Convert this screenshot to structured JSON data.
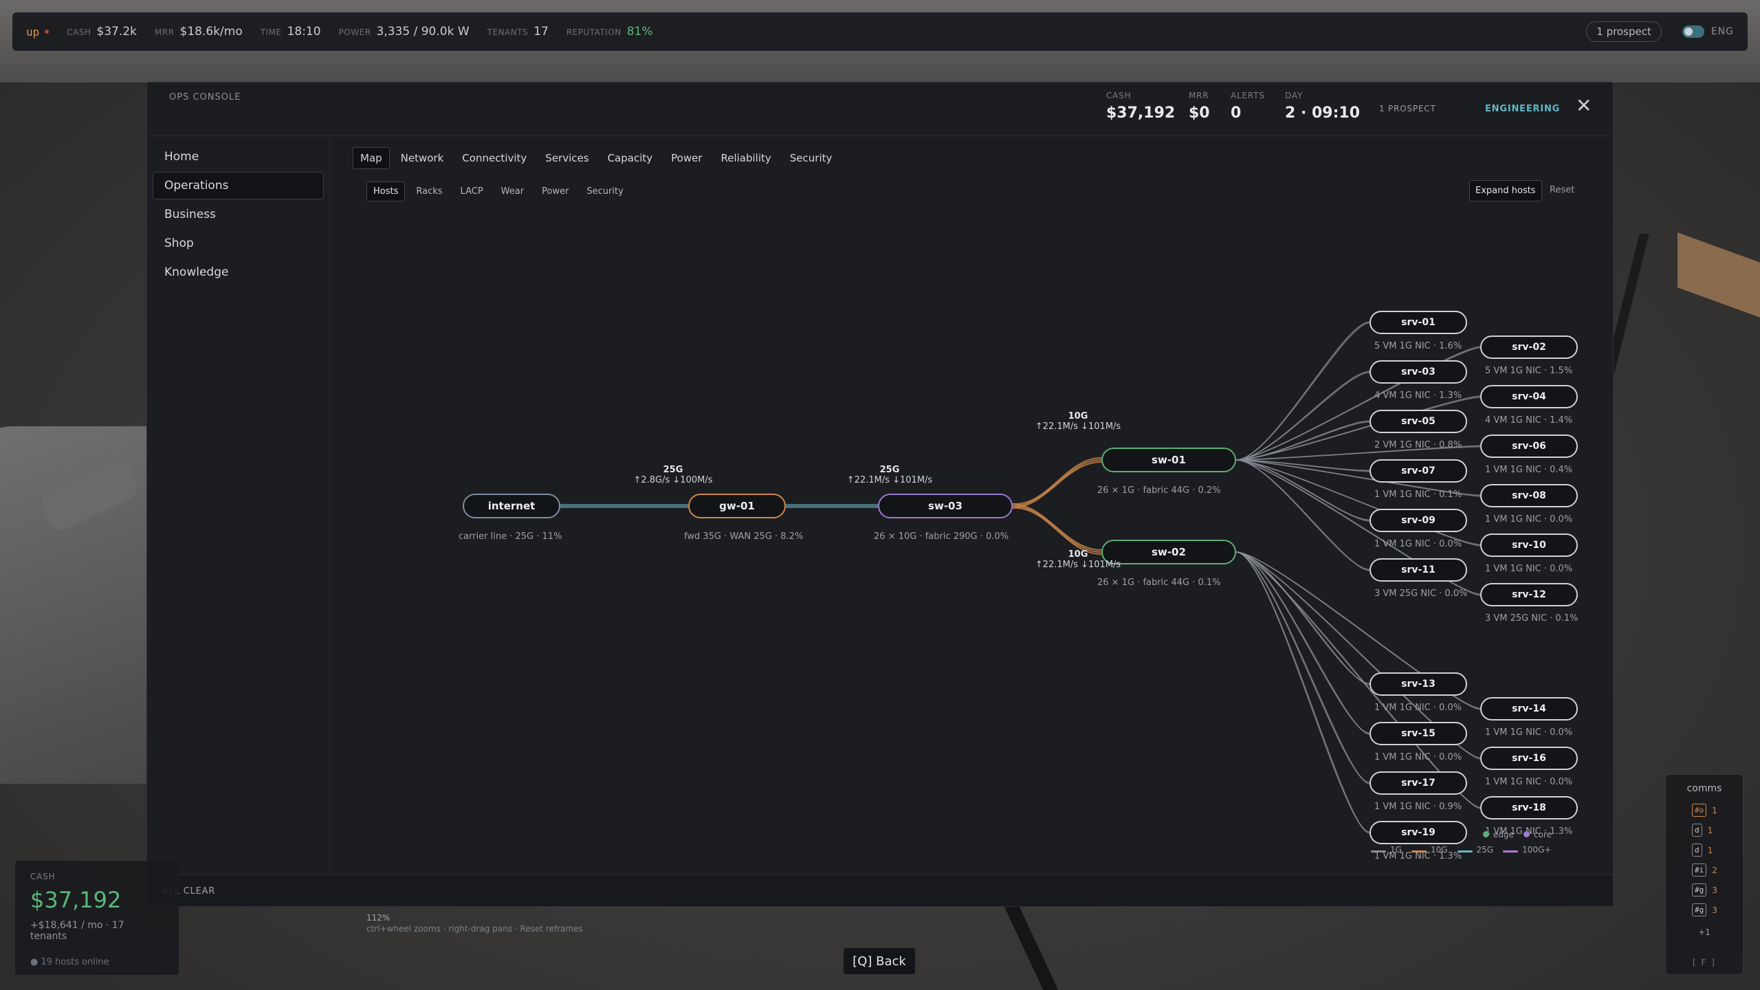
{
  "hud": {
    "logo": "up",
    "stats": [
      {
        "key": "CASH",
        "value": "$37.2k"
      },
      {
        "key": "MRR",
        "value": "$18.6k/mo"
      },
      {
        "key": "TIME",
        "value": "18:10"
      },
      {
        "key": "POWER",
        "value": "3,335 / 90.0k W"
      },
      {
        "key": "TENANTS",
        "value": "17"
      },
      {
        "key": "REPUTATION",
        "value": "81%"
      }
    ],
    "prospect": "1 prospect",
    "lang": "ENG"
  },
  "console": {
    "title": "OPS CONSOLE",
    "header": {
      "cash": {
        "key": "CASH",
        "value": "$37,192"
      },
      "mrr": {
        "key": "MRR",
        "value": "$0"
      },
      "alerts": {
        "key": "ALERTS",
        "value": "0"
      },
      "day": {
        "key": "DAY",
        "value": "2 · 09:10"
      },
      "prospect": "1 PROSPECT",
      "mode": "ENGINEERING",
      "close": "✕"
    },
    "sidebar": [
      "Home",
      "Operations",
      "Business",
      "Shop",
      "Knowledge"
    ],
    "tabs": [
      "Map",
      "Network",
      "Connectivity",
      "Services",
      "Capacity",
      "Power",
      "Reliability",
      "Security"
    ],
    "subtabs": [
      "Hosts",
      "Racks",
      "LACP",
      "Wear",
      "Power",
      "Security"
    ],
    "expand_label": "Expand hosts",
    "reset_label": "Reset",
    "footer": "ALL CLEAR",
    "zoom": "112%",
    "hint": "ctrl+wheel zooms · right-drag pans · Reset reframes"
  },
  "map": {
    "core": [
      {
        "id": "internet",
        "name": "internet",
        "info": "carrier line · 25G · 11%"
      },
      {
        "id": "gw-01",
        "name": "gw-01",
        "info": "fwd 35G · WAN 25G · 8.2%"
      },
      {
        "id": "sw-03",
        "name": "sw-03",
        "info": "26 × 10G · fabric 290G · 0.0%"
      },
      {
        "id": "sw-01",
        "name": "sw-01",
        "info": "26 × 1G · fabric 44G · 0.2%"
      },
      {
        "id": "sw-02",
        "name": "sw-02",
        "info": "26 × 1G · fabric 44G · 0.1%"
      }
    ],
    "links": [
      {
        "speed": "25G",
        "rate": "↑2.8G/s  ↓100M/s"
      },
      {
        "speed": "25G",
        "rate": "↑22.1M/s  ↓101M/s"
      },
      {
        "speed": "10G",
        "rate": "↑22.1M/s  ↓101M/s"
      },
      {
        "speed": "10G",
        "rate": "↑22.1M/s  ↓101M/s"
      }
    ],
    "servers": [
      {
        "name": "srv-01",
        "info": "5 VM 1G NIC · 1.6%"
      },
      {
        "name": "srv-02",
        "info": "5 VM 1G NIC · 1.5%"
      },
      {
        "name": "srv-03",
        "info": "4 VM 1G NIC · 1.3%"
      },
      {
        "name": "srv-04",
        "info": "4 VM 1G NIC · 1.4%"
      },
      {
        "name": "srv-05",
        "info": "2 VM 1G NIC · 0.8%"
      },
      {
        "name": "srv-06",
        "info": "1 VM 1G NIC · 0.4%"
      },
      {
        "name": "srv-07",
        "info": "1 VM 1G NIC · 0.1%"
      },
      {
        "name": "srv-08",
        "info": "1 VM 1G NIC · 0.0%"
      },
      {
        "name": "srv-09",
        "info": "1 VM 1G NIC · 0.0%"
      },
      {
        "name": "srv-10",
        "info": "1 VM 1G NIC · 0.0%"
      },
      {
        "name": "srv-11",
        "info": "3 VM 25G NIC · 0.0%"
      },
      {
        "name": "srv-12",
        "info": "3 VM 25G NIC · 0.1%"
      },
      {
        "name": "srv-13",
        "info": "1 VM 1G NIC · 0.0%"
      },
      {
        "name": "srv-14",
        "info": "1 VM 1G NIC · 0.0%"
      },
      {
        "name": "srv-15",
        "info": "1 VM 1G NIC · 0.0%"
      },
      {
        "name": "srv-16",
        "info": "1 VM 1G NIC · 0.0%"
      },
      {
        "name": "srv-17",
        "info": "1 VM 1G NIC · 0.9%"
      },
      {
        "name": "srv-18",
        "info": "1 VM 1G NIC · 1.3%"
      },
      {
        "name": "srv-19",
        "info": "1 VM 1G NIC · 1.3%"
      }
    ],
    "legend": {
      "roles": [
        {
          "name": "edge",
          "color": "#5fae7a"
        },
        {
          "name": "core",
          "color": "#9b7ad0"
        }
      ],
      "speeds": [
        {
          "name": "1G",
          "color": "#8a8e95"
        },
        {
          "name": "10G",
          "color": "#d0884a"
        },
        {
          "name": "25G",
          "color": "#6bb5c4"
        },
        {
          "name": "100G+",
          "color": "#b07ad6"
        }
      ]
    }
  },
  "cashcard": {
    "key": "CASH",
    "value": "$37,192",
    "sub": "+$18,641 / mo · 17 tenants",
    "hosts": "● 19 hosts online"
  },
  "comms": {
    "title": "comms",
    "items": [
      {
        "badge": "#o",
        "count": "1",
        "accent": true
      },
      {
        "badge": "d",
        "count": "1",
        "accent": false
      },
      {
        "badge": "d",
        "count": "1",
        "accent": false
      },
      {
        "badge": "#i",
        "count": "2",
        "accent": false
      },
      {
        "badge": "#g",
        "count": "3",
        "accent": false
      },
      {
        "badge": "#g",
        "count": "3",
        "accent": false
      }
    ],
    "more": "+1",
    "shortcut": "[ F ]"
  },
  "back": "[Q] Back"
}
